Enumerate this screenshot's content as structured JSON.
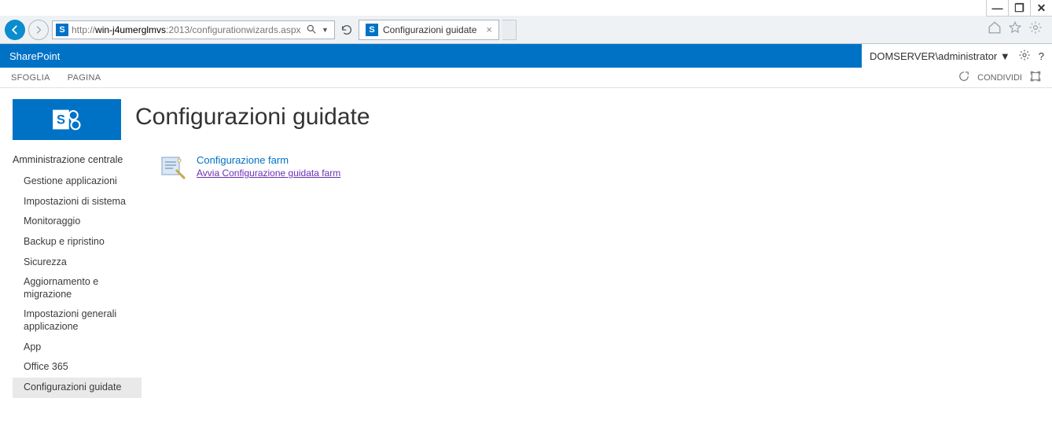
{
  "window_controls": {
    "min": "—",
    "max": "❐",
    "close": "✕"
  },
  "browser": {
    "url_prefix": "http://",
    "url_host": "win-j4umerglmvs",
    "url_rest": ":2013/configurationwizards.aspx",
    "tab_title": "Configurazioni guidate"
  },
  "suitebar": {
    "brand": "SharePoint",
    "user": "DOMSERVER\\administrator"
  },
  "ribbon": {
    "tab_browse": "SFOGLIA",
    "tab_page": "PAGINA",
    "share": "CONDIVIDI"
  },
  "page": {
    "title": "Configurazioni guidate"
  },
  "nav": {
    "header": "Amministrazione centrale",
    "items": [
      "Gestione applicazioni",
      "Impostazioni di sistema",
      "Monitoraggio",
      "Backup e ripristino",
      "Sicurezza",
      "Aggiornamento e migrazione",
      "Impostazioni generali applicazione",
      "App",
      "Office 365",
      "Configurazioni guidate"
    ],
    "selected_index": 9
  },
  "wizard": {
    "title": "Configurazione farm",
    "link": "Avvia Configurazione guidata farm"
  }
}
